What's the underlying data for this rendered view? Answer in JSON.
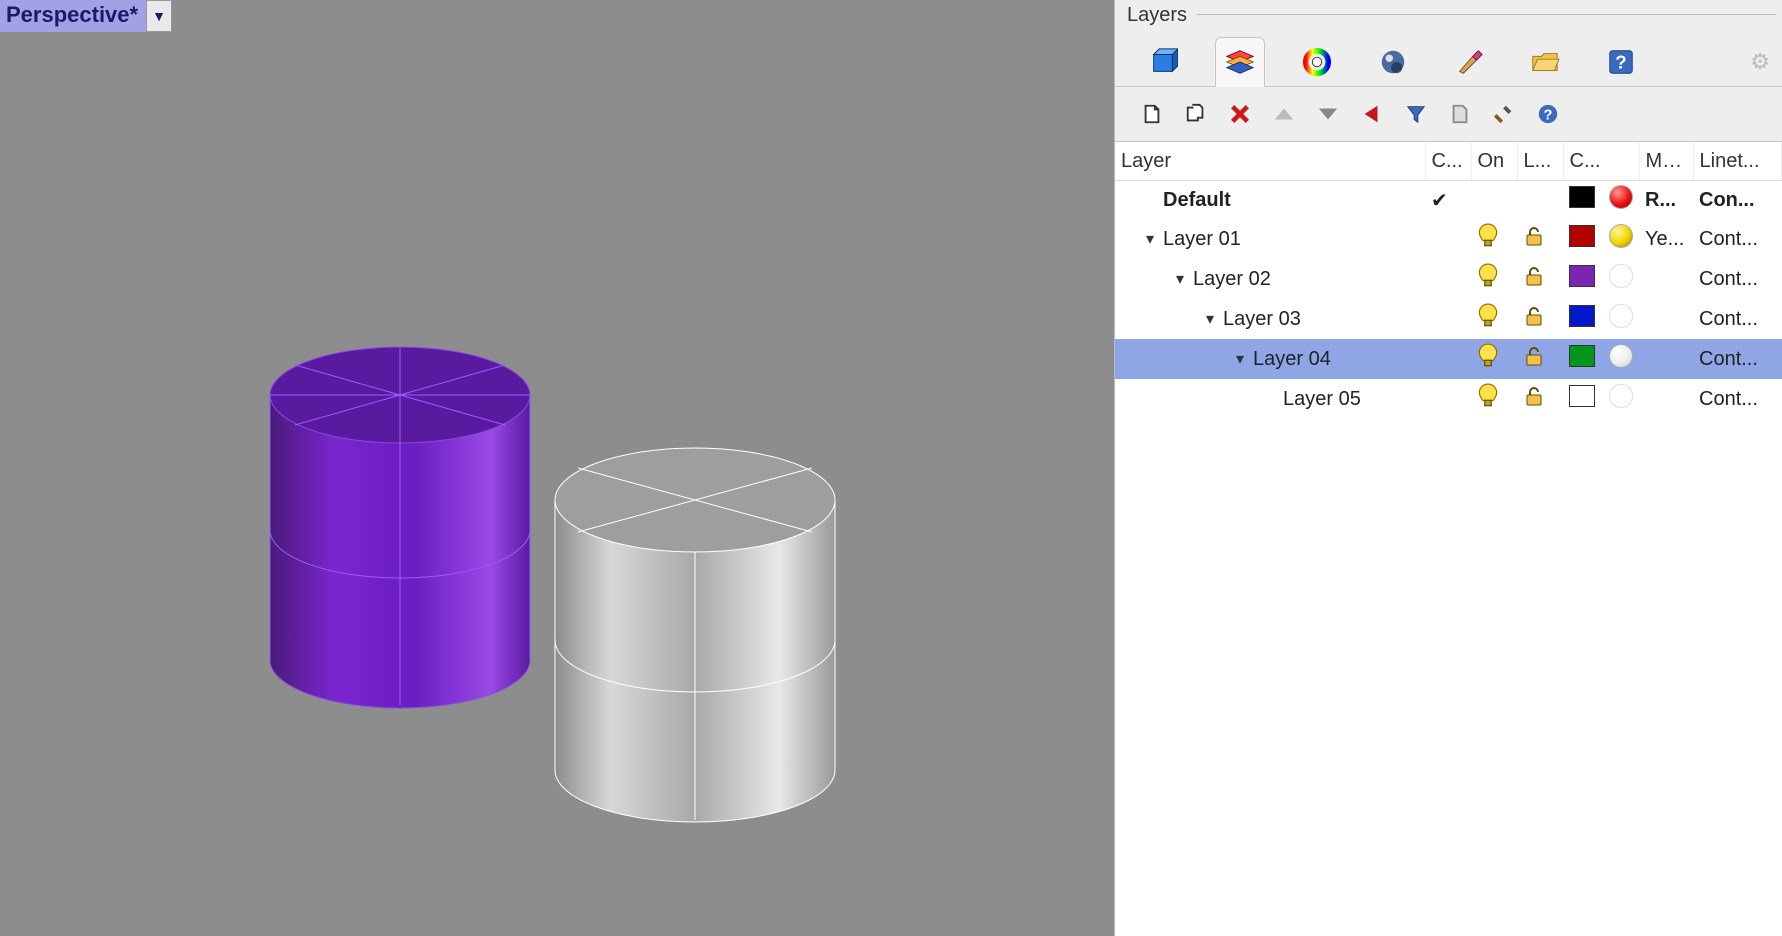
{
  "viewport": {
    "title": "Perspective*"
  },
  "panel": {
    "title": "Layers"
  },
  "columns": {
    "name": "Layer",
    "current": "C...",
    "on": "On",
    "lock": "L...",
    "color": "C...",
    "material": "Mate...",
    "linetype": "Linet..."
  },
  "layers": [
    {
      "name": "Default",
      "indent": 0,
      "expander": "",
      "bold": true,
      "current": true,
      "on": false,
      "lock": false,
      "selected": false,
      "color": "#000000",
      "matSwatch": "red",
      "material": "R...",
      "linetype": "Con..."
    },
    {
      "name": "Layer 01",
      "indent": 0,
      "expander": "v",
      "bold": false,
      "current": false,
      "on": true,
      "lock": true,
      "selected": false,
      "color": "#b40000",
      "matSwatch": "yellow",
      "material": "Ye...",
      "linetype": "Cont..."
    },
    {
      "name": "Layer 02",
      "indent": 1,
      "expander": "v",
      "bold": false,
      "current": false,
      "on": true,
      "lock": true,
      "selected": false,
      "color": "#7a26b3",
      "matSwatch": "none",
      "material": "",
      "linetype": "Cont..."
    },
    {
      "name": "Layer 03",
      "indent": 2,
      "expander": "v",
      "bold": false,
      "current": false,
      "on": true,
      "lock": true,
      "selected": false,
      "color": "#0018c8",
      "matSwatch": "none",
      "material": "",
      "linetype": "Cont..."
    },
    {
      "name": "Layer 04",
      "indent": 3,
      "expander": "v",
      "bold": false,
      "current": false,
      "on": true,
      "lock": true,
      "selected": true,
      "color": "#009619",
      "matSwatch": "white",
      "material": "",
      "linetype": "Cont..."
    },
    {
      "name": "Layer 05",
      "indent": 4,
      "expander": "",
      "bold": false,
      "current": false,
      "on": true,
      "lock": true,
      "selected": false,
      "color": "#ffffff",
      "matSwatch": "none",
      "material": "",
      "linetype": "Cont..."
    }
  ]
}
